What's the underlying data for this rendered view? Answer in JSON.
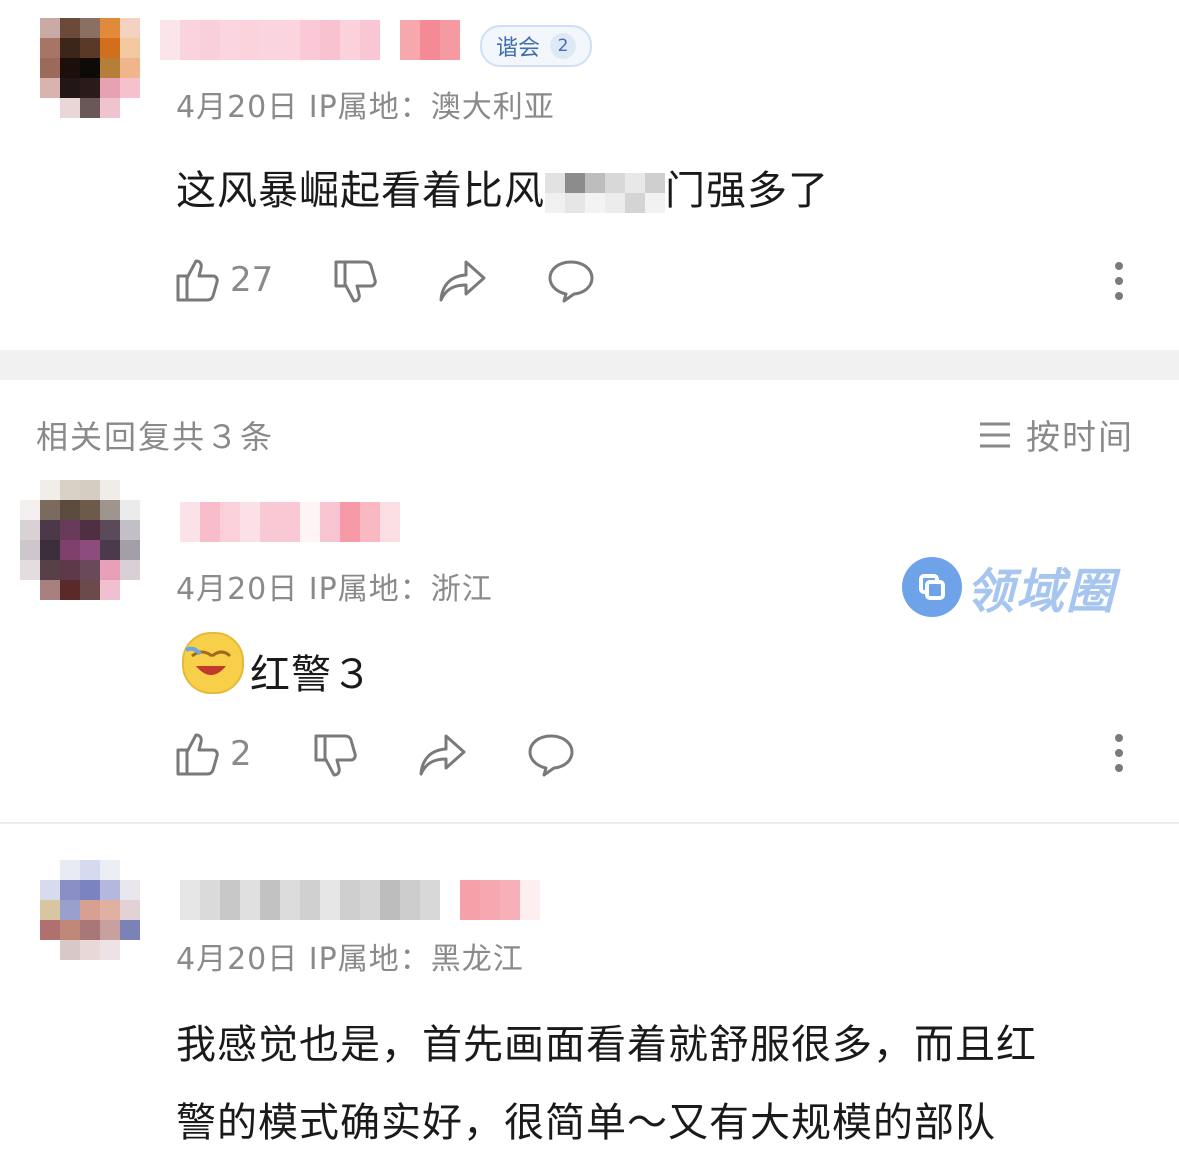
{
  "comment": {
    "badge_label": "谐会",
    "badge_level": "2",
    "meta": "4月20日  IP属地：澳大利亚",
    "text_before": "这风暴崛起看着比风",
    "text_after": "门强多了",
    "likes": "27"
  },
  "replies": {
    "header": "相关回复共３条",
    "sort_label": "按时间",
    "items": [
      {
        "meta": "4月20日  IP属地：浙江",
        "text": "红警３",
        "likes": "2"
      },
      {
        "meta": "4月20日  IP属地：黑龙江",
        "text_line1": "我感觉也是，首先画面看着就舒服很多，而且红",
        "text_line2": "警的模式确实好，很简单～又有大规模的部队"
      }
    ]
  },
  "watermark": {
    "text": "领域圈"
  }
}
